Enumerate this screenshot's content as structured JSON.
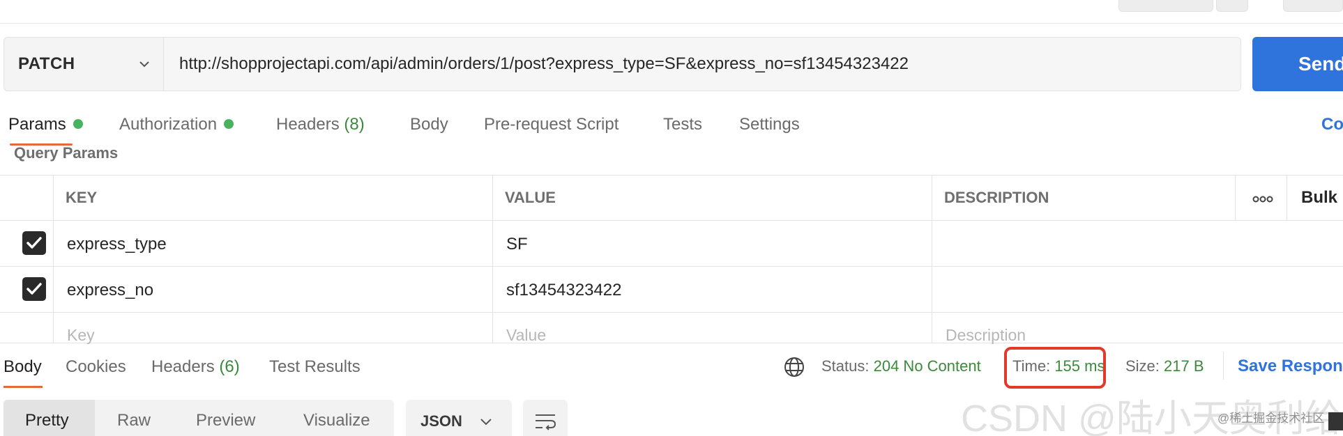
{
  "request": {
    "method": "PATCH",
    "url": "http://shopprojectapi.com/api/admin/orders/1/post?express_type=SF&express_no=sf13454323422",
    "send_label": "Send"
  },
  "request_tabs": {
    "params": "Params",
    "authorization": "Authorization",
    "headers": "Headers",
    "headers_count": "(8)",
    "body": "Body",
    "pre_request": "Pre-request Script",
    "tests": "Tests",
    "settings": "Settings",
    "cookies_partial": "Co"
  },
  "params": {
    "section_label": "Query Params",
    "columns": {
      "key": "KEY",
      "value": "VALUE",
      "description": "DESCRIPTION",
      "bulk": "Bulk E"
    },
    "rows": [
      {
        "key": "express_type",
        "value": "SF",
        "description": "",
        "checked": true
      },
      {
        "key": "express_no",
        "value": "sf13454323422",
        "description": "",
        "checked": true
      }
    ],
    "placeholders": {
      "key": "Key",
      "value": "Value",
      "description": "Description"
    }
  },
  "response": {
    "tabs": {
      "body": "Body",
      "cookies": "Cookies",
      "headers": "Headers",
      "headers_count": "(6)",
      "test_results": "Test Results"
    },
    "status_label": "Status:",
    "status_value": "204 No Content",
    "time_label": "Time:",
    "time_value": "155 ms",
    "size_label": "Size:",
    "size_value": "217 B",
    "save_label": "Save Respon",
    "view_modes": [
      "Pretty",
      "Raw",
      "Preview",
      "Visualize"
    ],
    "format": "JSON"
  },
  "watermark": {
    "main": "CSDN @陆小天奥利给",
    "sub": "@稀土掘金技术社区"
  },
  "colors": {
    "accent_blue": "#2f73dc",
    "status_green": "#3a8a3a",
    "tab_underline": "#e46a3a",
    "highlight_red": "#e03a2a"
  }
}
